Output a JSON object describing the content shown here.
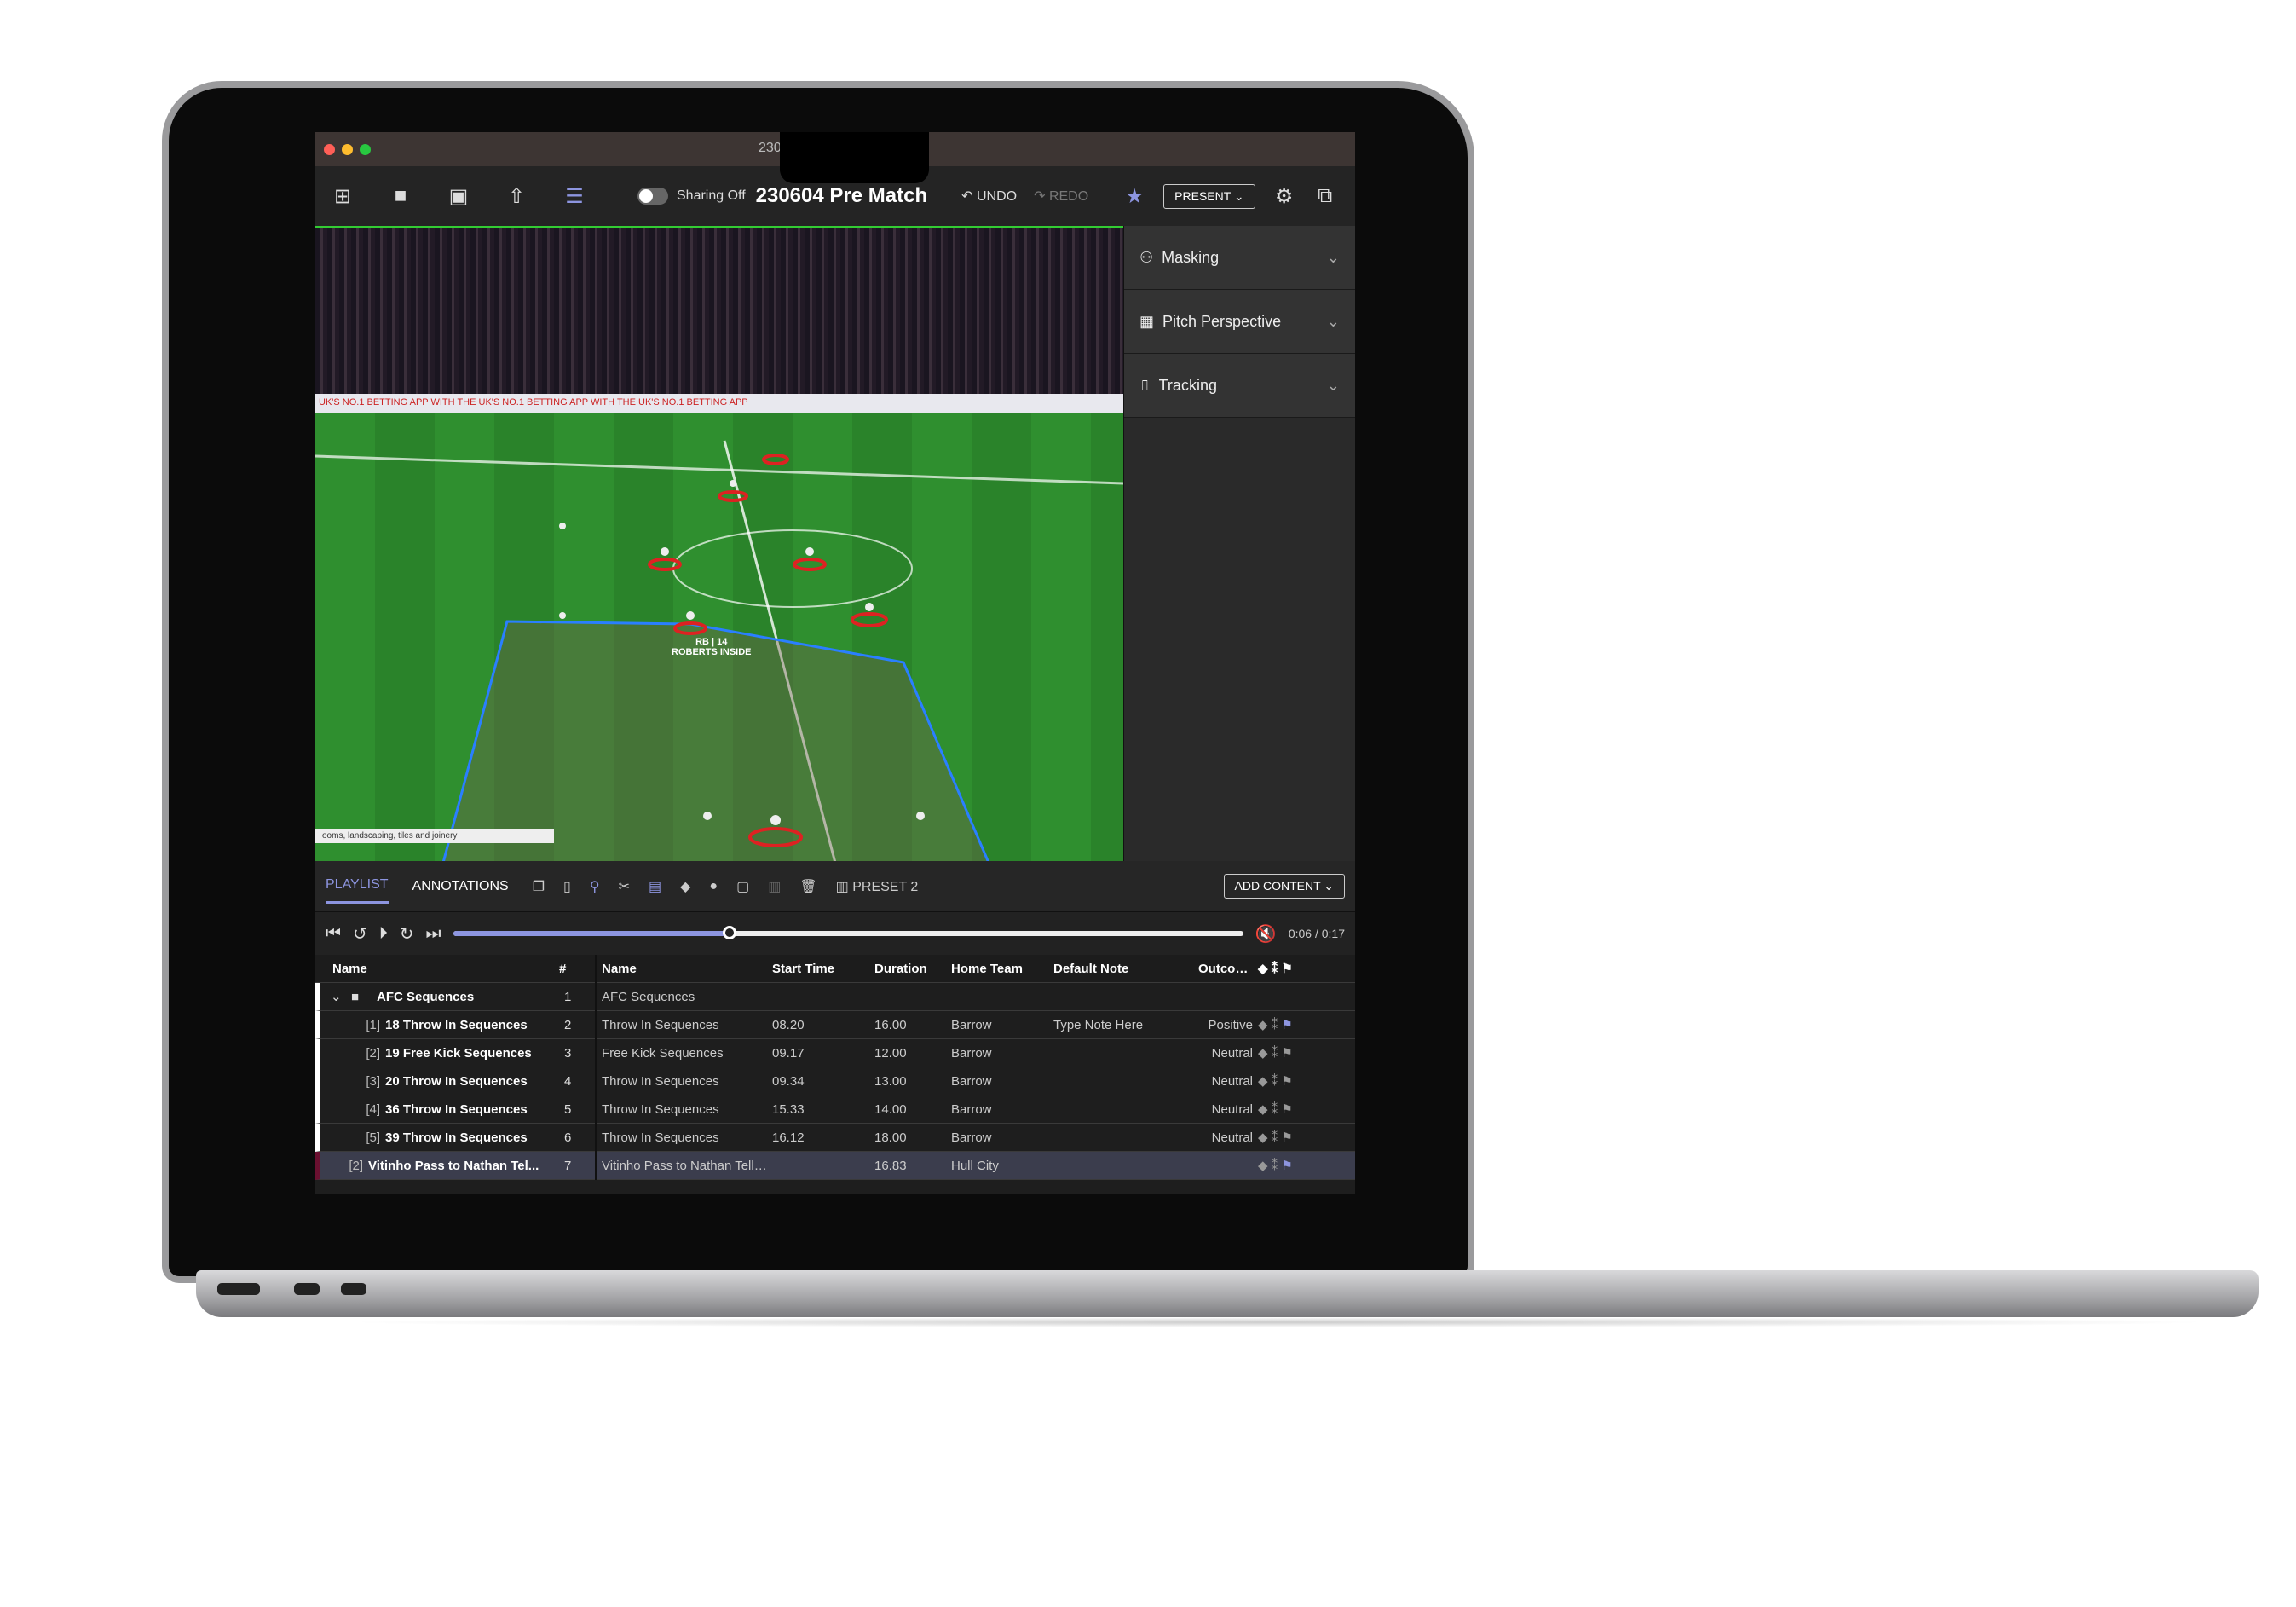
{
  "window": {
    "title": "230604 Pre Match",
    "title_partial": "Pre",
    "title_partial_end": "tch"
  },
  "toolbar": {
    "sharing": "Sharing Off",
    "title": "230604 Pre Match",
    "undo": "UNDO",
    "redo": "REDO",
    "present": "PRESENT",
    "icons": [
      "new-playlist-icon",
      "folder-icon",
      "save-icon",
      "share-icon",
      "layout-icon",
      "star-icon",
      "gear-icon",
      "external-icon"
    ]
  },
  "video": {
    "ad_text": "UK'S NO.1 BETTING APP   WITH THE UK'S NO.1 BETTING APP   WITH THE UK'S NO.1 BETTING APP",
    "label_line1": "RB | 14",
    "label_line2": "ROBERTS INSIDE",
    "caption": "ooms, landscaping, tiles and joinery"
  },
  "side_panel": {
    "items": [
      {
        "label": "Masking",
        "icon": "masking-icon"
      },
      {
        "label": "Pitch Perspective",
        "icon": "pitch-icon"
      },
      {
        "label": "Tracking",
        "icon": "tracking-icon"
      }
    ]
  },
  "tabs": {
    "playlist": "PLAYLIST",
    "annotations": "ANNOTATIONS",
    "preset": "PRESET 2",
    "add_content": "ADD CONTENT"
  },
  "player": {
    "time": "0:06 / 0:17",
    "progress": 0.35
  },
  "accent": "#8d95e0",
  "playlist": {
    "headers": {
      "name": "Name",
      "num": "#"
    },
    "rows": [
      {
        "name": "AFC Sequences",
        "num": "1",
        "folder": true
      },
      {
        "idx": "[1]",
        "name": "18 Throw In Sequences",
        "num": "2"
      },
      {
        "idx": "[2]",
        "name": "19 Free Kick Sequences",
        "num": "3"
      },
      {
        "idx": "[3]",
        "name": "20 Throw In Sequences",
        "num": "4"
      },
      {
        "idx": "[4]",
        "name": "36 Throw In Sequences",
        "num": "5"
      },
      {
        "idx": "[5]",
        "name": "39 Throw In Sequences",
        "num": "6"
      },
      {
        "idx": "[2]",
        "name": "Vitinho Pass to Nathan Tel...",
        "num": "7"
      }
    ]
  },
  "details": {
    "headers": [
      "Name",
      "Start Time",
      "Duration",
      "Home Team",
      "Default Note",
      "Outcome"
    ],
    "rows": [
      [
        "AFC Sequences",
        "",
        "",
        "",
        "",
        ""
      ],
      [
        "Throw In Sequences",
        "08.20",
        "16.00",
        "Barrow",
        "Type Note Here",
        "Positive"
      ],
      [
        "Free Kick Sequences",
        "09.17",
        "12.00",
        "Barrow",
        "",
        "Neutral"
      ],
      [
        "Throw In Sequences",
        "09.34",
        "13.00",
        "Barrow",
        "",
        "Neutral"
      ],
      [
        "Throw In Sequences",
        "15.33",
        "14.00",
        "Barrow",
        "",
        "Neutral"
      ],
      [
        "Throw In Sequences",
        "16.12",
        "18.00",
        "Barrow",
        "",
        "Neutral"
      ],
      [
        "Vitinho Pass to Nathan Tella ...",
        "",
        "16.83",
        "Hull City",
        "",
        ""
      ]
    ]
  }
}
